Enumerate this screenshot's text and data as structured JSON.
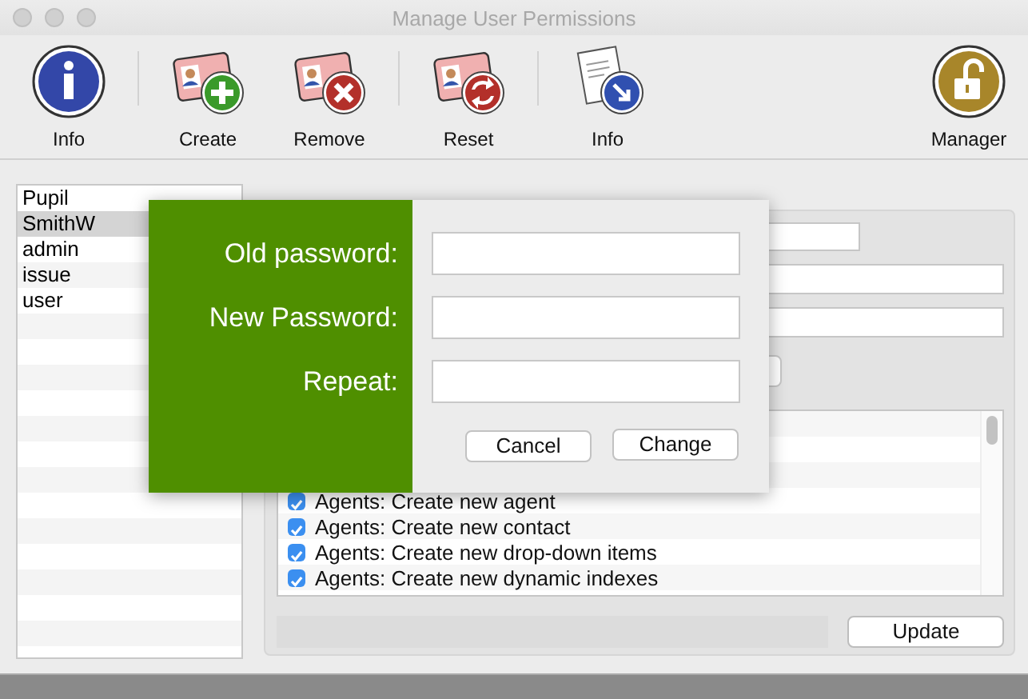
{
  "window": {
    "title": "Manage User Permissions"
  },
  "toolbar": {
    "groups": [
      [
        {
          "label": "Info",
          "kind": "info"
        }
      ],
      [
        {
          "label": "Create",
          "kind": "create"
        },
        {
          "label": "Remove",
          "kind": "remove"
        }
      ],
      [
        {
          "label": "Reset",
          "kind": "reset"
        }
      ],
      [
        {
          "label": "Info",
          "kind": "document"
        }
      ]
    ],
    "end": {
      "label": "Manager",
      "kind": "lock"
    }
  },
  "users": [
    {
      "name": "Pupil",
      "selected": false
    },
    {
      "name": "SmithW",
      "selected": true
    },
    {
      "name": "admin",
      "selected": false
    },
    {
      "name": "issue",
      "selected": false
    },
    {
      "name": "user",
      "selected": false
    }
  ],
  "permissions": {
    "items": [
      {
        "label": "Agents: Create new agent",
        "checked": true
      },
      {
        "label": "Agents: Create new contact",
        "checked": true
      },
      {
        "label": "Agents: Create new drop-down items",
        "checked": true
      },
      {
        "label": "Agents: Create new dynamic indexes",
        "checked": true
      }
    ],
    "update_button": "Update"
  },
  "dialog": {
    "fields": [
      {
        "label": "Old password:"
      },
      {
        "label": "New Password:"
      },
      {
        "label": "Repeat:"
      }
    ],
    "buttons": [
      {
        "label": "Cancel",
        "kind": "cancel"
      },
      {
        "label": "Change",
        "kind": "change"
      }
    ]
  }
}
